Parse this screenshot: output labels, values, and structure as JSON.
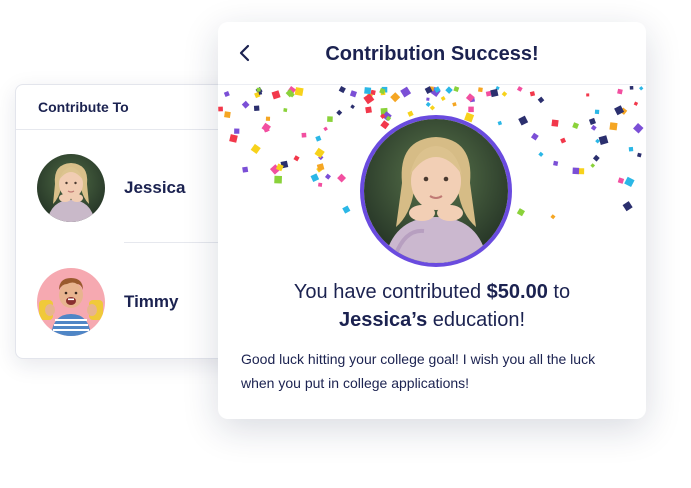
{
  "contribute_card": {
    "title": "Contribute To",
    "people": [
      {
        "name": "Jessica"
      },
      {
        "name": "Timmy"
      }
    ]
  },
  "success_card": {
    "title": "Contribution Success!",
    "message": {
      "prefix": "You have contributed ",
      "amount": "$50.00",
      "middle": " to",
      "recipient": "Jessica’s",
      "suffix": " education!"
    },
    "note": "Good luck hitting your college goal! I wish you all the luck when you put in college applications!"
  },
  "colors": {
    "navy": "#1b2250",
    "avatar_ring": "#6a4bdf",
    "confetti": [
      "#f24fa0",
      "#2bb7e6",
      "#8ad23a",
      "#f5a623",
      "#7b4fd6",
      "#2b2f6e",
      "#f2384b",
      "#f7d21b"
    ]
  },
  "icons": {
    "back": "chevron-left-icon"
  }
}
